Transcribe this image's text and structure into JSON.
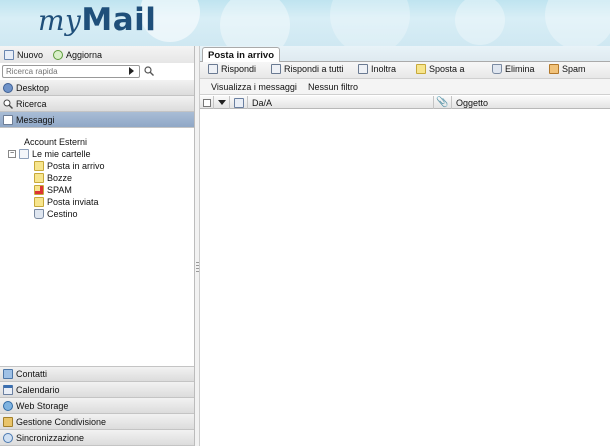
{
  "header": {
    "logo_my": "my",
    "logo_mail": "Mail"
  },
  "left": {
    "buttons": {
      "new": "Nuovo",
      "update": "Aggiorna"
    },
    "search_placeholder": "Ricerca rapida",
    "nav_top": [
      "Desktop",
      "Ricerca",
      "Messaggi"
    ],
    "tree": {
      "external": "Account Esterni",
      "my_folders": "Le mie cartelle",
      "folders": [
        "Posta in arrivo",
        "Bozze",
        "SPAM",
        "Posta inviata",
        "Cestino"
      ]
    },
    "nav_bottom": [
      "Contatti",
      "Calendario",
      "Web Storage",
      "Gestione Condivisione",
      "Sincronizzazione"
    ]
  },
  "tab": "Posta in arrivo",
  "toolbar": {
    "reply": "Rispondi",
    "reply_all": "Rispondi a tutti",
    "forward": "Inoltra",
    "move": "Sposta a",
    "delete": "Elimina",
    "spam": "Spam"
  },
  "filters": {
    "view": "Visualizza i messaggi",
    "filter": "Nessun filtro"
  },
  "columns": {
    "from": "Da/A",
    "subject": "Oggetto"
  },
  "colors": {
    "brand": "#1f4f7a",
    "active_nav": "#9bb1cd",
    "header_bg": "#cfe8f2"
  }
}
